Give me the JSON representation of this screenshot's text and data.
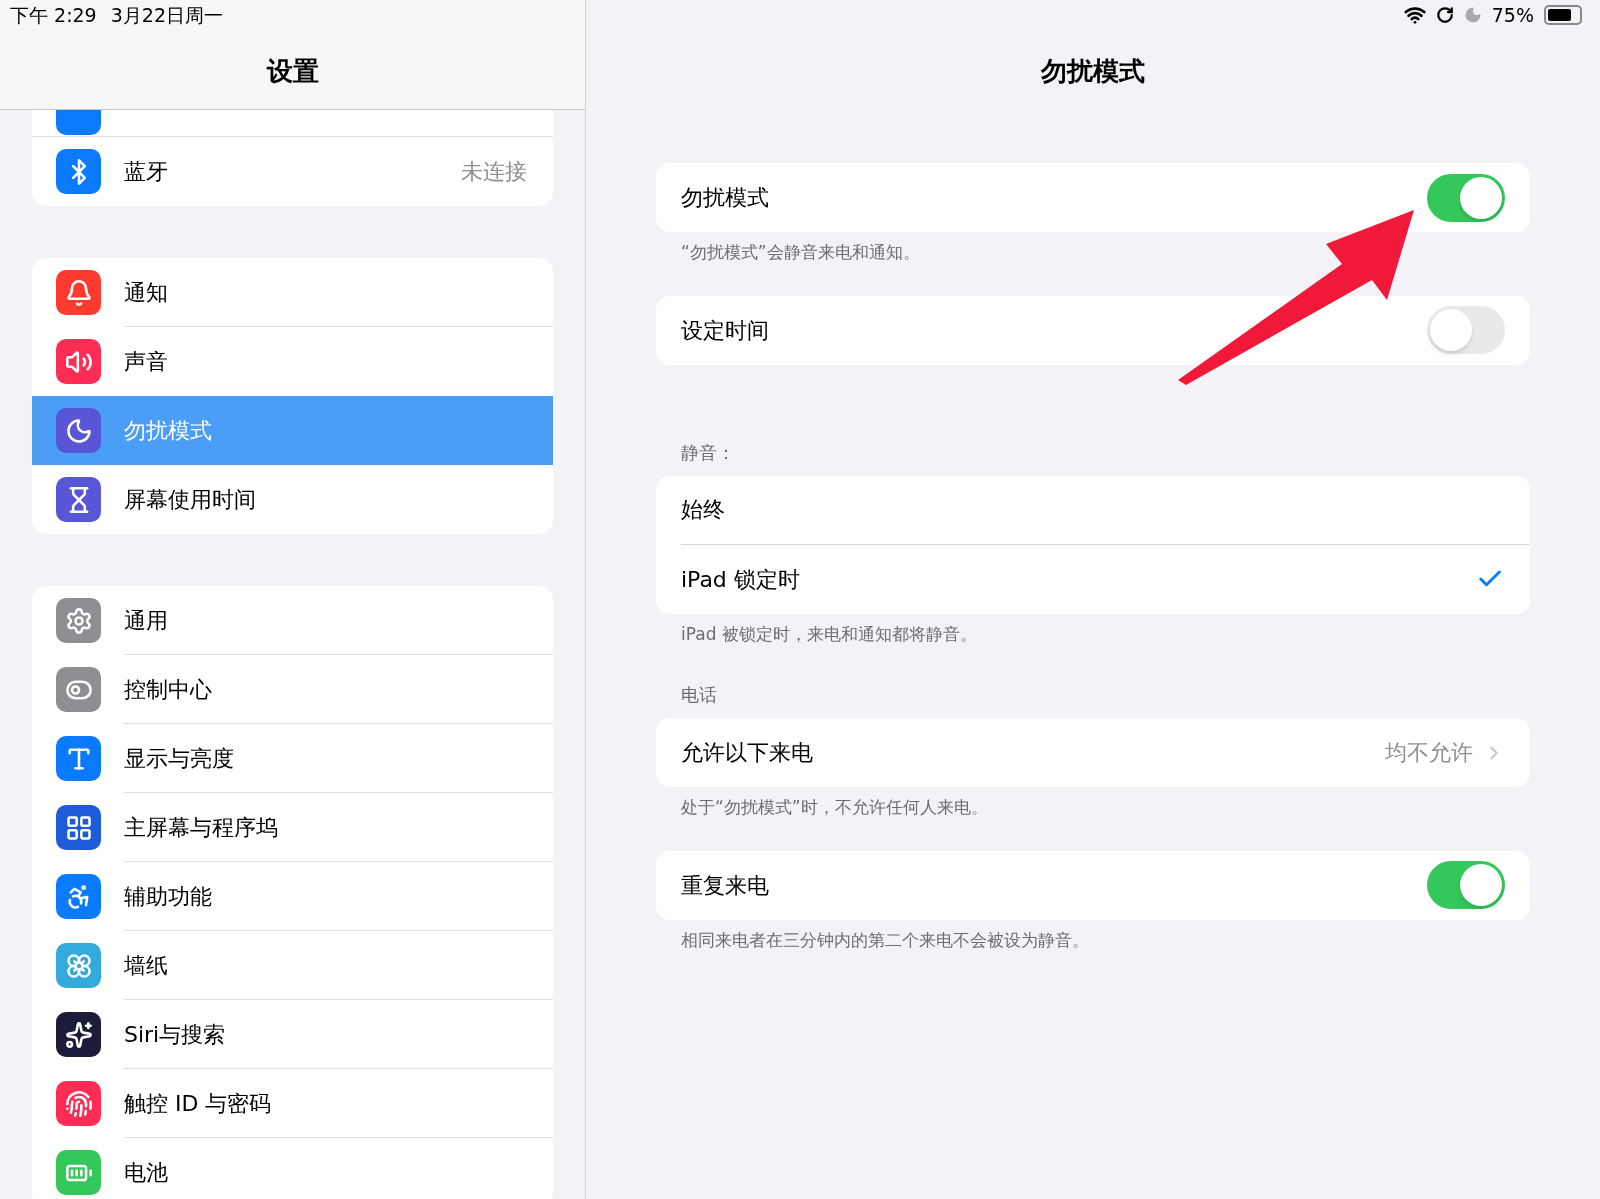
{
  "status_bar": {
    "time": "下午 2:29",
    "date": "3月22日周一",
    "battery": "75%"
  },
  "sidebar": {
    "title": "设置",
    "groups": [
      {
        "items": [
          {
            "label": "蓝牙",
            "value": "未连接",
            "selected": false
          }
        ]
      },
      {
        "items": [
          {
            "label": "通知",
            "selected": false
          },
          {
            "label": "声音",
            "selected": false
          },
          {
            "label": "勿扰模式",
            "selected": true
          },
          {
            "label": "屏幕使用时间",
            "selected": false
          }
        ]
      },
      {
        "items": [
          {
            "label": "通用",
            "selected": false
          },
          {
            "label": "控制中心",
            "selected": false
          },
          {
            "label": "显示与亮度",
            "selected": false
          },
          {
            "label": "主屏幕与程序坞",
            "selected": false
          },
          {
            "label": "辅助功能",
            "selected": false
          },
          {
            "label": "墙纸",
            "selected": false
          },
          {
            "label": "Siri与搜索",
            "selected": false
          },
          {
            "label": "触控 ID 与密码",
            "selected": false
          },
          {
            "label": "电池",
            "selected": false
          }
        ]
      }
    ]
  },
  "detail": {
    "title": "勿扰模式",
    "groups": [
      {
        "rows": [
          {
            "kind": "toggle",
            "label": "勿扰模式",
            "on": true
          }
        ],
        "footer": "“勿扰模式”会静音来电和通知。"
      },
      {
        "rows": [
          {
            "kind": "toggle",
            "label": "设定时间",
            "on": false
          }
        ]
      },
      {
        "header": "静音：",
        "rows": [
          {
            "kind": "check",
            "label": "始终",
            "selected": false
          },
          {
            "kind": "check",
            "label": "iPad 锁定时",
            "selected": true
          }
        ],
        "footer": "iPad 被锁定时，来电和通知都将静音。"
      },
      {
        "header": "电话",
        "rows": [
          {
            "kind": "link",
            "label": "允许以下来电",
            "value": "均不允许"
          }
        ],
        "footer": "处于“勿扰模式”时，不允许任何人来电。"
      },
      {
        "rows": [
          {
            "kind": "toggle",
            "label": "重复来电",
            "on": true
          }
        ],
        "footer": "相同来电者在三分钟内的第二个来电不会被设为静音。"
      }
    ]
  }
}
